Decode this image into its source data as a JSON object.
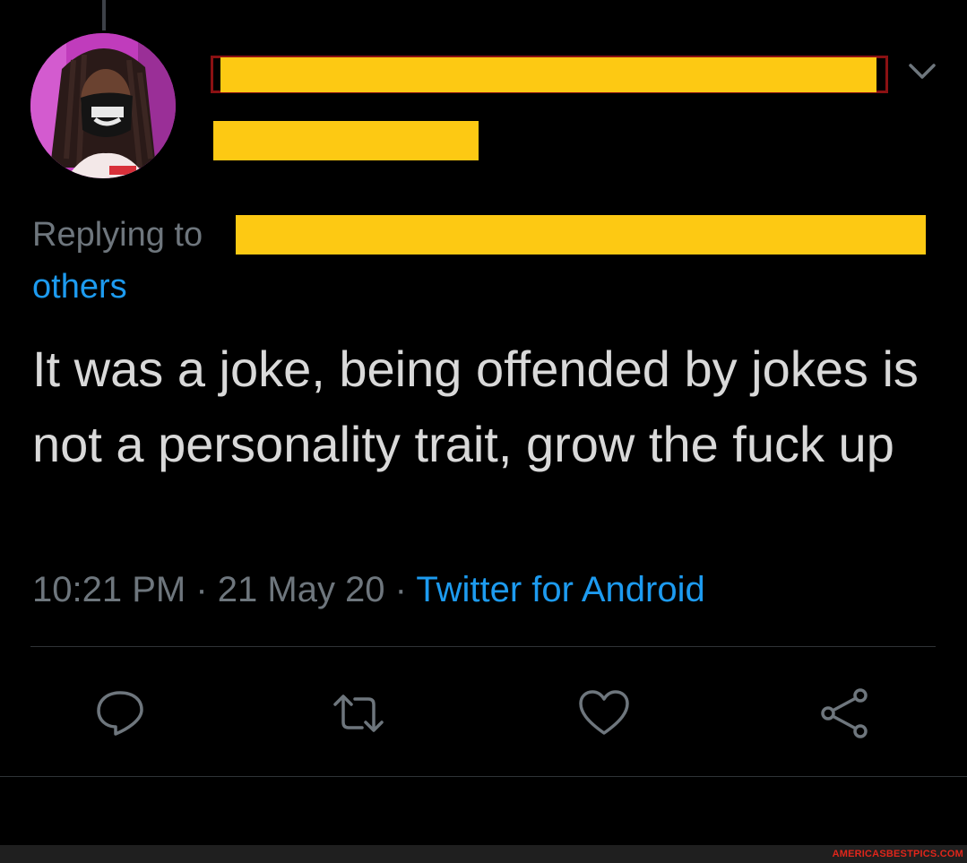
{
  "tweet": {
    "replying_to_label": "Replying to",
    "others_link": "others",
    "text": "It was a joke, being offended by jokes is not a personality trait, grow the fuck up",
    "time": "10:21 PM",
    "separator": " · ",
    "date": "21 May 20",
    "source": "Twitter for Android"
  },
  "icons": {
    "thread": "thread-line",
    "menu": "chevron-down-icon",
    "reply": "reply-icon",
    "retweet": "retweet-icon",
    "like": "heart-icon",
    "share": "share-icon"
  },
  "colors": {
    "background": "#000000",
    "text": "#d9d9d9",
    "muted": "#6e767d",
    "link": "#1d9bf0",
    "redaction": "#fdc913",
    "redaction_outline": "#8b1113"
  },
  "watermark": "AMERICASBESTPICS.COM"
}
